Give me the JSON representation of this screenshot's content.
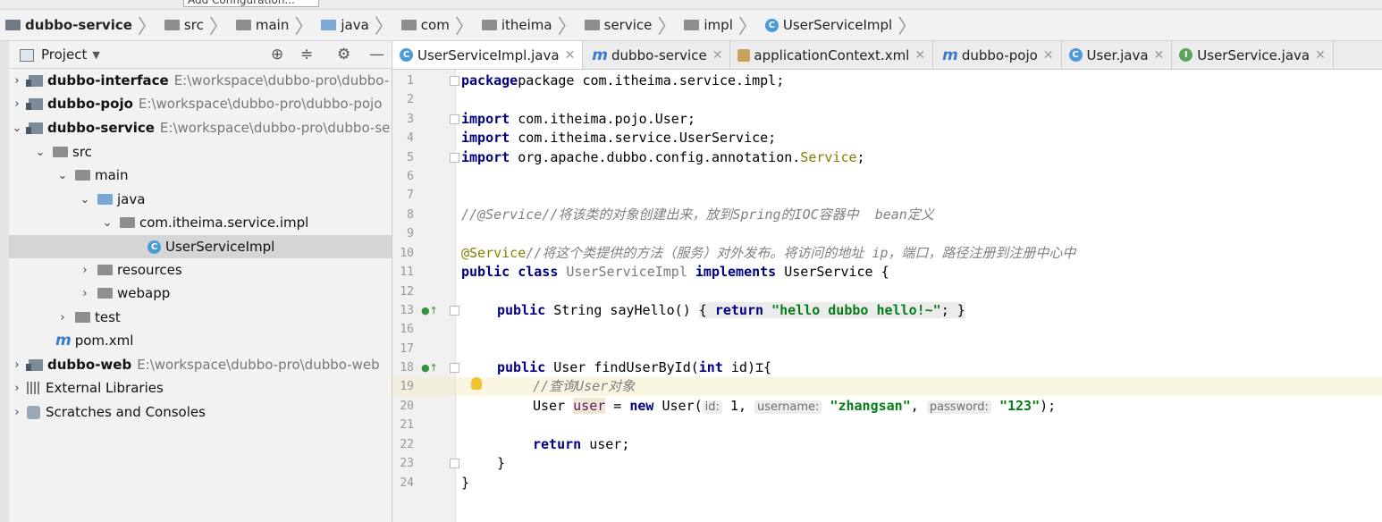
{
  "toolbar": {
    "run_config": "Add Configuration..."
  },
  "breadcrumb": [
    {
      "label": "dubbo-service",
      "icon": "module-folder-icon",
      "bold": true
    },
    {
      "label": "src",
      "icon": "folder-icon"
    },
    {
      "label": "main",
      "icon": "folder-icon"
    },
    {
      "label": "java",
      "icon": "source-folder-icon"
    },
    {
      "label": "com",
      "icon": "package-icon"
    },
    {
      "label": "itheima",
      "icon": "package-icon"
    },
    {
      "label": "service",
      "icon": "package-icon"
    },
    {
      "label": "impl",
      "icon": "package-icon"
    },
    {
      "label": "UserServiceImpl",
      "icon": "class-icon"
    }
  ],
  "project": {
    "title": "Project",
    "tree": [
      {
        "label": "dubbo-interface",
        "path": "E:\\workspace\\dubbo-pro\\dubbo-",
        "type": "module",
        "arrow": ">",
        "depth": 0
      },
      {
        "label": "dubbo-pojo",
        "path": "E:\\workspace\\dubbo-pro\\dubbo-pojo",
        "type": "module",
        "arrow": ">",
        "depth": 0
      },
      {
        "label": "dubbo-service",
        "path": "E:\\workspace\\dubbo-pro\\dubbo-se",
        "type": "module",
        "arrow": "v",
        "depth": 0
      },
      {
        "label": "src",
        "type": "folder",
        "arrow": "v",
        "depth": 1
      },
      {
        "label": "main",
        "type": "folder",
        "arrow": "v",
        "depth": 2
      },
      {
        "label": "java",
        "type": "srcfolder",
        "arrow": "v",
        "depth": 3
      },
      {
        "label": "com.itheima.service.impl",
        "type": "package",
        "arrow": "v",
        "depth": 4
      },
      {
        "label": "UserServiceImpl",
        "type": "class",
        "arrow": "",
        "depth": 6,
        "selected": true
      },
      {
        "label": "resources",
        "type": "resfolder",
        "arrow": ">",
        "depth": 3
      },
      {
        "label": "webapp",
        "type": "webfolder",
        "arrow": ">",
        "depth": 3
      },
      {
        "label": "test",
        "type": "folder",
        "arrow": ">",
        "depth": 2
      },
      {
        "label": "pom.xml",
        "type": "maven",
        "arrow": "",
        "depth": 2
      },
      {
        "label": "dubbo-web",
        "path": "E:\\workspace\\dubbo-pro\\dubbo-web",
        "type": "module",
        "arrow": ">",
        "depth": 0
      },
      {
        "label": "External Libraries",
        "type": "library",
        "arrow": ">",
        "depth": 0
      },
      {
        "label": "Scratches and Consoles",
        "type": "scratch",
        "arrow": ">",
        "depth": 0
      }
    ]
  },
  "tabs": [
    {
      "label": "UserServiceImpl.java",
      "icon": "class-icon",
      "active": true
    },
    {
      "label": "dubbo-service",
      "icon": "maven-icon"
    },
    {
      "label": "applicationContext.xml",
      "icon": "xml-icon"
    },
    {
      "label": "dubbo-pojo",
      "icon": "maven-icon"
    },
    {
      "label": "User.java",
      "icon": "class-icon"
    },
    {
      "label": "UserService.java",
      "icon": "interface-icon"
    }
  ],
  "editor": {
    "line_numbers": [
      "1",
      "2",
      "3",
      "4",
      "5",
      "6",
      "7",
      "8",
      "9",
      "10",
      "11",
      "12",
      "13",
      "16",
      "17",
      "18",
      "19",
      "20",
      "21",
      "22",
      "23",
      "24"
    ],
    "code": {
      "l1": "package com.itheima.service.impl;",
      "l3_kw": "import",
      "l3": " com.itheima.pojo.User;",
      "l4_kw": "import",
      "l4": " com.itheima.service.UserService;",
      "l5_kw": "import",
      "l5_a": " org.apache.dubbo.config.annotation.",
      "l5_b": "Service",
      "l5_c": ";",
      "l8": "//@Service//将该类的对象创建出来，放到Spring的IOC容器中  bean定义",
      "l10_a": "@Service",
      "l10_b": "//将这个类提供的方法（服务）对外发布。将访问的地址 ip，端口，路径注册到注册中心中",
      "l11_kw1": "public class ",
      "l11_cls": "UserServiceImpl",
      "l11_kw2": " implements ",
      "l11_b": "UserService {",
      "l13_kw": "public",
      "l13_a": " String sayHello() ",
      "l13_b": "{ ",
      "l13_kw2": "return",
      "l13_str": " \"hello dubbo hello!~\"",
      "l13_c": "; }",
      "l18_kw": "public",
      "l18_a": " User findUserById(",
      "l18_kw2": "int",
      "l18_b": " id)",
      "l19": "//查询User对象",
      "l20_a": "User ",
      "l20_var": "user",
      "l20_b": " = ",
      "l20_kw": "new",
      "l20_c": " User(",
      "l20_h1": "id:",
      "l20_v1": " 1, ",
      "l20_h2": "username:",
      "l20_v2": " \"zhangsan\"",
      "l20_d": ", ",
      "l20_h3": "password:",
      "l20_v3": " \"123\"",
      "l20_e": ");",
      "l22_kw": "return",
      "l22": " user;",
      "l23": "}",
      "l24": "}"
    }
  }
}
